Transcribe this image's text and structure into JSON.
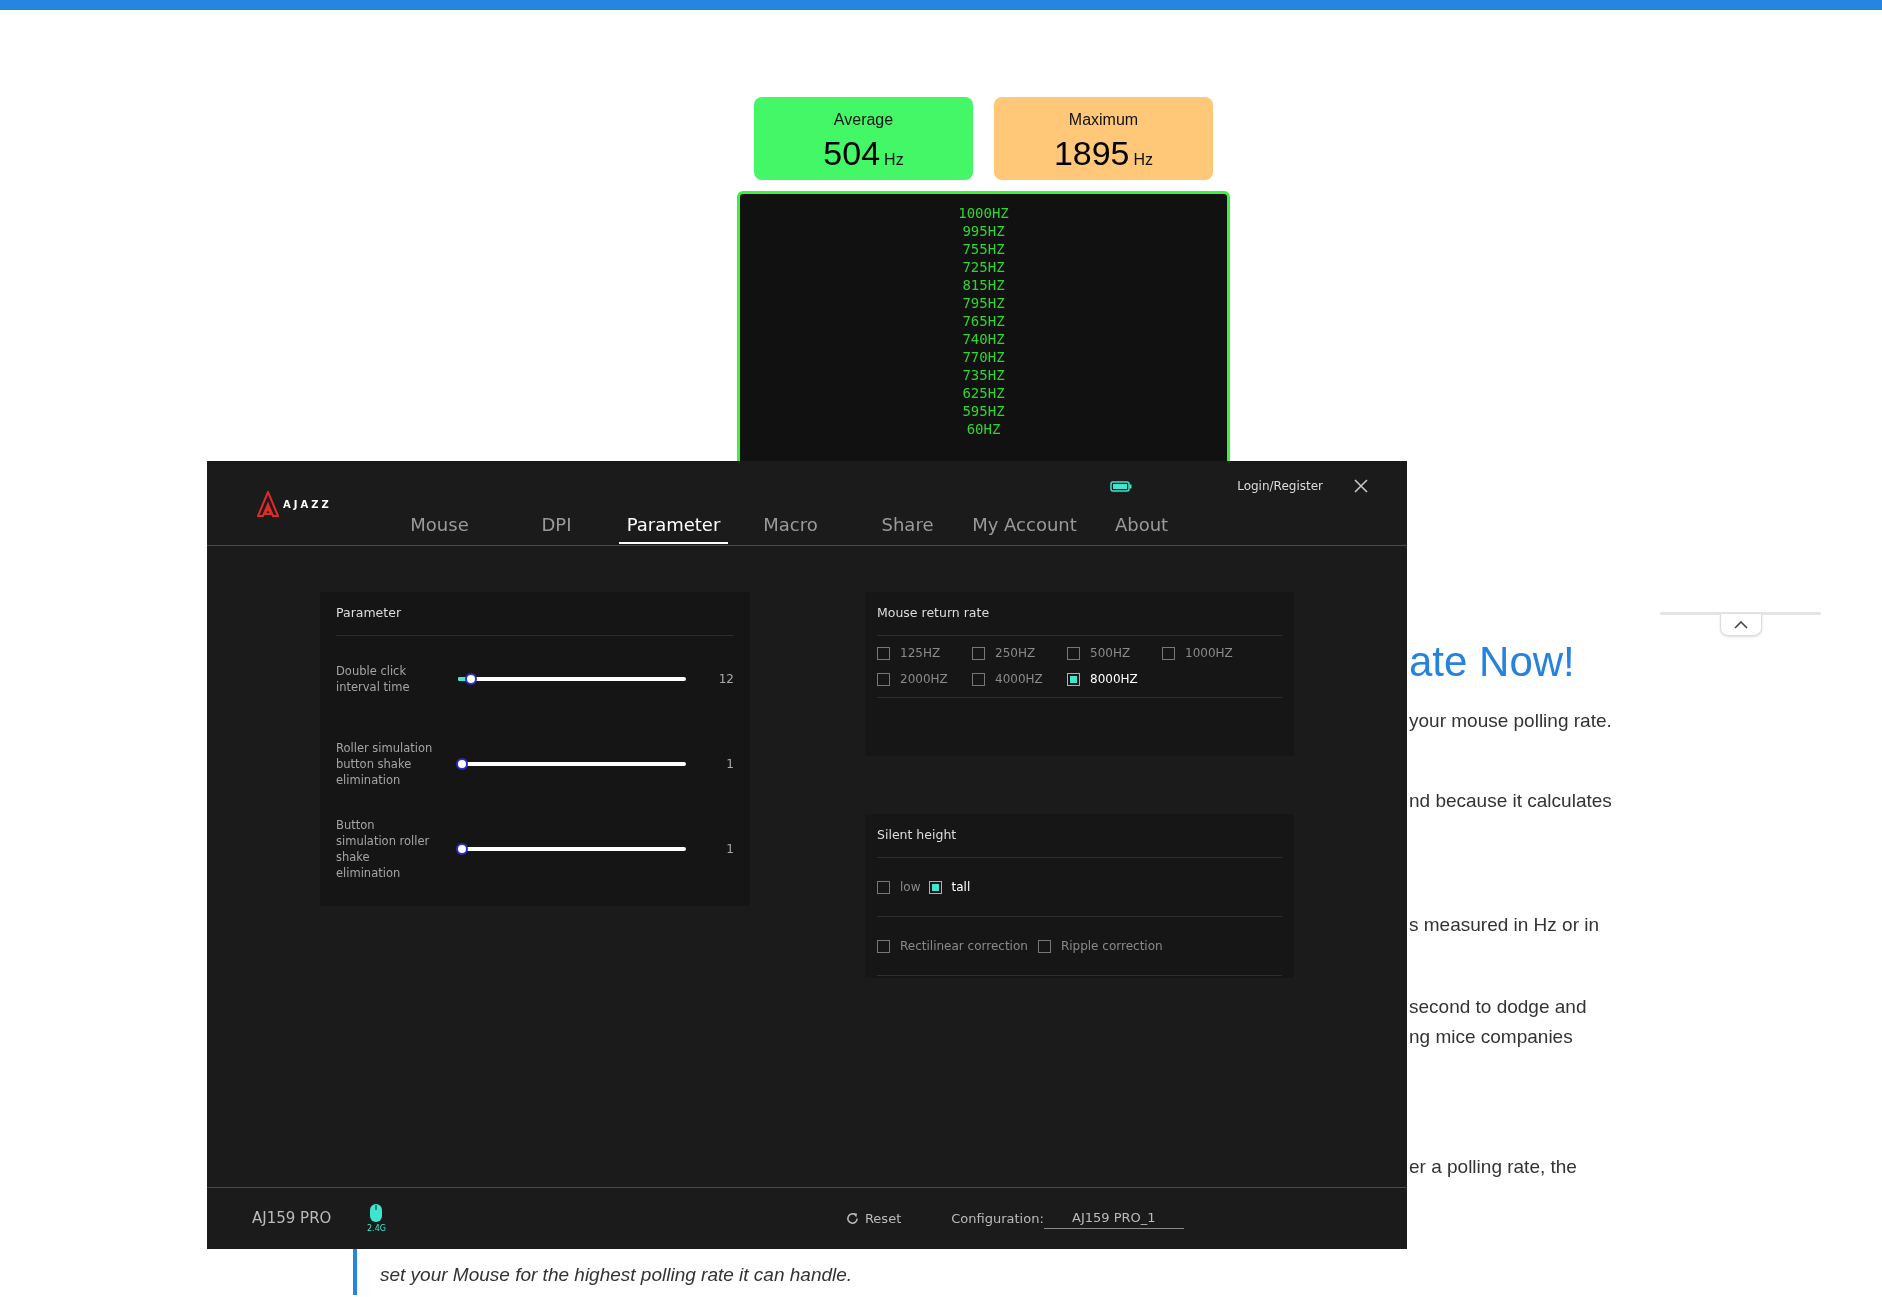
{
  "page": {
    "stats": [
      {
        "label": "Average",
        "value": "504",
        "unit": "Hz",
        "color": "#44f767"
      },
      {
        "label": "Maximum",
        "value": "1895",
        "unit": "Hz",
        "color": "#fec878"
      }
    ],
    "rate_log": [
      "1000HZ",
      "995HZ",
      "755HZ",
      "725HZ",
      "815HZ",
      "795HZ",
      "765HZ",
      "740HZ",
      "770HZ",
      "735HZ",
      "625HZ",
      "595HZ",
      "60HZ"
    ],
    "article": {
      "heading": "ate Now!",
      "paragraphs": [
        [
          "your mouse polling rate."
        ],
        [
          "nd because it calculates"
        ],
        [
          "s measured in Hz or in"
        ],
        [
          "second to dodge and",
          "ng mice companies"
        ],
        [
          "er a polling rate, the"
        ]
      ],
      "note": "set your Mouse for the highest polling rate it can handle."
    }
  },
  "app": {
    "logo": "AJAZZ",
    "login": "Login/Register",
    "tabs": [
      {
        "label": "Mouse",
        "selected": false
      },
      {
        "label": "DPI",
        "selected": false
      },
      {
        "label": "Parameter",
        "selected": true
      },
      {
        "label": "Macro",
        "selected": false
      },
      {
        "label": "Share",
        "selected": false
      },
      {
        "label": "My Account",
        "selected": false
      },
      {
        "label": "About",
        "selected": false
      }
    ],
    "parameter_panel": {
      "title": "Parameter",
      "sliders": [
        {
          "label": "Double click interval time",
          "level": 0.04,
          "reading": "12"
        },
        {
          "label": "Roller simulation button shake elimination",
          "level": 0,
          "reading": "1"
        },
        {
          "label": "Button simulation roller shake elimination",
          "level": 0,
          "reading": "1"
        }
      ]
    },
    "return_rate": {
      "title": "Mouse return rate",
      "options": [
        {
          "label": "125HZ",
          "checked": false
        },
        {
          "label": "250HZ",
          "checked": false
        },
        {
          "label": "500HZ",
          "checked": false
        },
        {
          "label": "1000HZ",
          "checked": false
        },
        {
          "label": "2000HZ",
          "checked": false
        },
        {
          "label": "4000HZ",
          "checked": false
        },
        {
          "label": "8000HZ",
          "checked": true
        }
      ]
    },
    "silent_height": {
      "title": "Silent height",
      "options": [
        {
          "label": "low",
          "checked": false
        },
        {
          "label": "tall",
          "checked": true
        }
      ]
    },
    "corrections": [
      {
        "label": "Rectilinear correction",
        "checked": false
      },
      {
        "label": "Ripple correction",
        "checked": false
      }
    ],
    "footer": {
      "device": "AJ159 PRO",
      "connection": "2.4G",
      "reset": "Reset",
      "config_label": "Configuration:",
      "config_value": "AJ159 PRO_1"
    }
  }
}
